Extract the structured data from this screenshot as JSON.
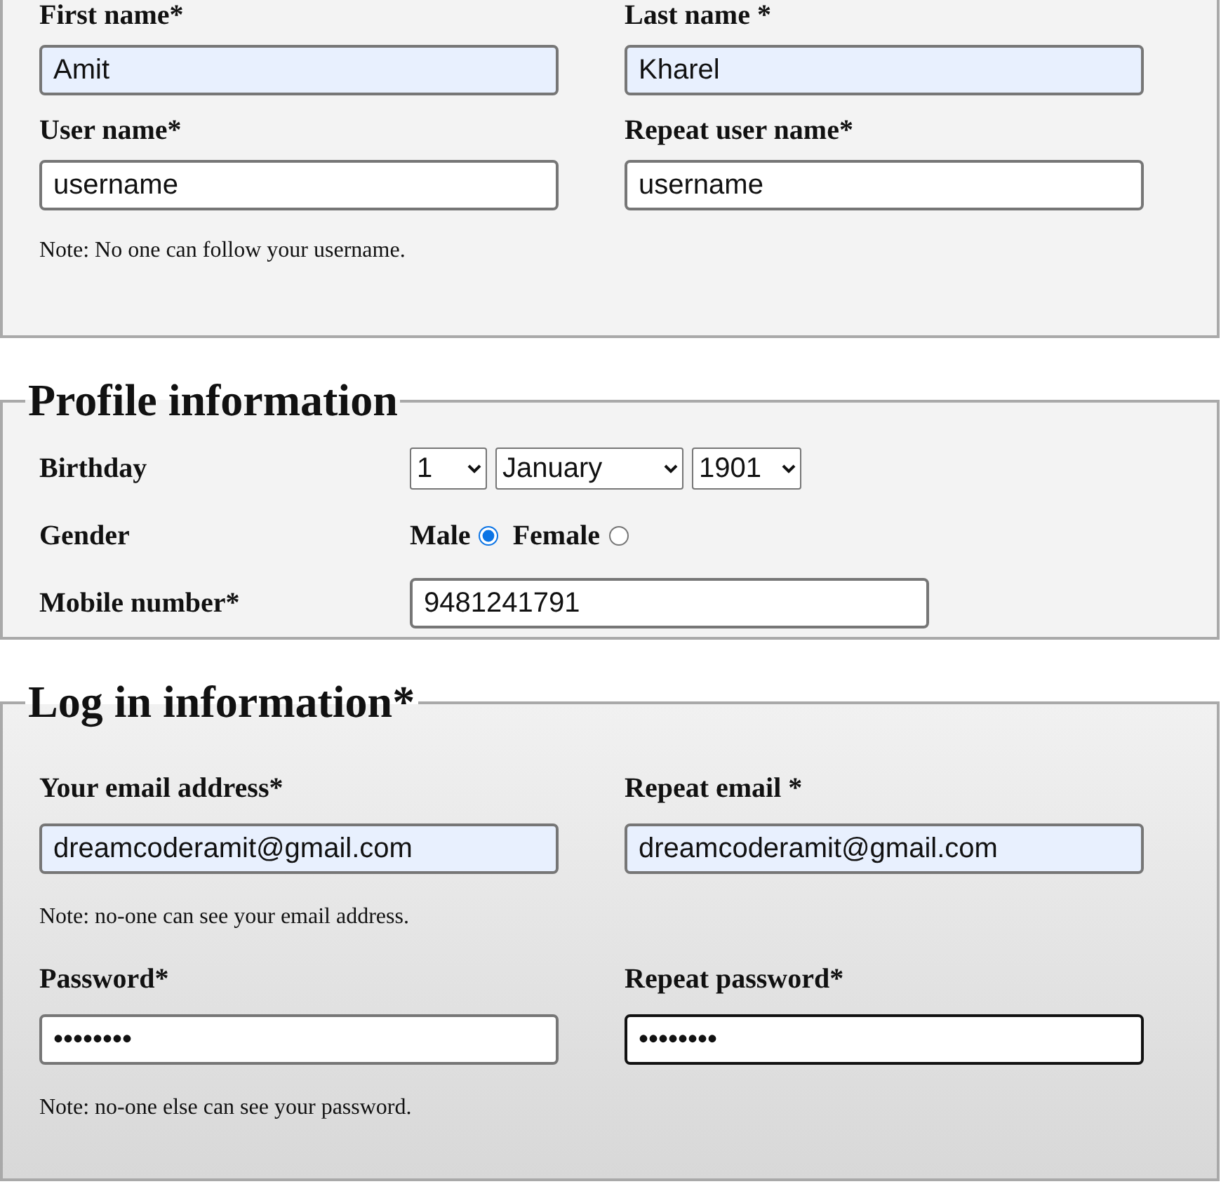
{
  "account": {
    "fields": [
      {
        "label": "First name*",
        "value": "Amit",
        "autofilled": true,
        "focused": false
      },
      {
        "label": "Last name *",
        "value": "Kharel",
        "autofilled": true,
        "focused": false
      },
      {
        "label": "User name*",
        "value": "username",
        "autofilled": false,
        "focused": false
      },
      {
        "label": "Repeat user name*",
        "value": "username",
        "autofilled": false,
        "focused": false
      }
    ],
    "note": "Note: No one can follow your username."
  },
  "profile": {
    "legend": "Profile information",
    "birthday": {
      "label": "Birthday",
      "day": "1",
      "month": "January",
      "year": "1901"
    },
    "gender": {
      "label": "Gender",
      "options": [
        {
          "label": "Male",
          "selected": true
        },
        {
          "label": "Female",
          "selected": false
        }
      ]
    },
    "mobile": {
      "label": "Mobile number*",
      "value": "9481241791"
    }
  },
  "login": {
    "legend": "Log in information*",
    "email_fields": [
      {
        "label": "Your email address*",
        "value": "dreamcoderamit@gmail.com",
        "autofilled": true,
        "focused": false
      },
      {
        "label": "Repeat email *",
        "value": "dreamcoderamit@gmail.com",
        "autofilled": true,
        "focused": false
      }
    ],
    "email_note": "Note: no-one can see your email address.",
    "password_fields": [
      {
        "label": "Password*",
        "value": "••••••••",
        "autofilled": false,
        "focused": false
      },
      {
        "label": "Repeat password*",
        "value": "••••••••",
        "autofilled": false,
        "focused": true
      }
    ],
    "password_note": "Note: no-one else can see your password."
  }
}
